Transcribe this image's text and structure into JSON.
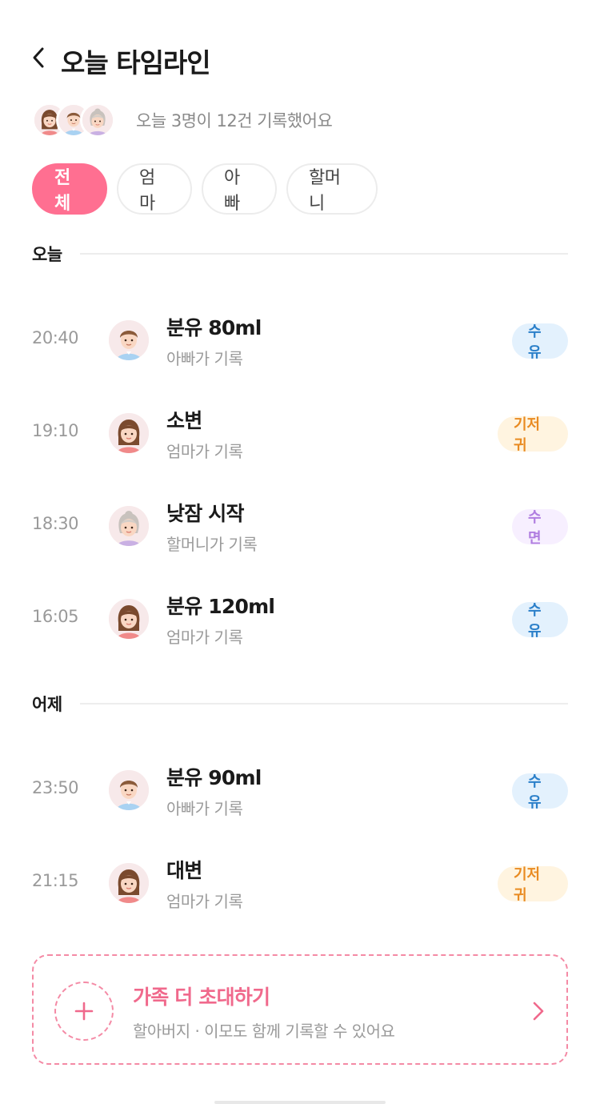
{
  "header": {
    "title": "오늘 타임라인"
  },
  "summary": {
    "text": "오늘 3명이 12건 기록했어요"
  },
  "filters": [
    "전체",
    "엄마",
    "아빠",
    "할머니"
  ],
  "sections": {
    "today": {
      "label": "오늘"
    },
    "yesterday": {
      "label": "어제"
    }
  },
  "records": {
    "r1": {
      "time": "20:40",
      "title": "분유 80ml",
      "by": "아빠가 기록",
      "tag": "수유",
      "avatar": "dad-avatar"
    },
    "r2": {
      "time": "19:10",
      "title": "소변",
      "by": "엄마가 기록",
      "tag": "기저귀",
      "avatar": "mom-avatar"
    },
    "r3": {
      "time": "18:30",
      "title": "낮잠 시작",
      "by": "할머니가 기록",
      "tag": "수면",
      "avatar": "grandma-avatar"
    },
    "r4": {
      "time": "16:05",
      "title": "분유 120ml",
      "by": "엄마가 기록",
      "tag": "수유",
      "avatar": "mom-avatar"
    },
    "r5": {
      "time": "23:50",
      "title": "분유 90ml",
      "by": "아빠가 기록",
      "tag": "수유",
      "avatar": "dad-avatar"
    },
    "r6": {
      "time": "21:15",
      "title": "대변",
      "by": "엄마가 기록",
      "tag": "기저귀",
      "avatar": "mom-avatar"
    }
  },
  "invite": {
    "title": "가족 더 초대하기",
    "subtitle": "할아버지 · 이모도 함께 기록할 수 있어요"
  },
  "colors": {
    "accent": "#ff6f91",
    "feeding_bg": "#e3f1fd",
    "feeding_fg": "#2a7fc9",
    "diaper_bg": "#fff4e0",
    "diaper_fg": "#e98b22",
    "sleep_bg": "#f7efff",
    "sleep_fg": "#b07de0"
  }
}
